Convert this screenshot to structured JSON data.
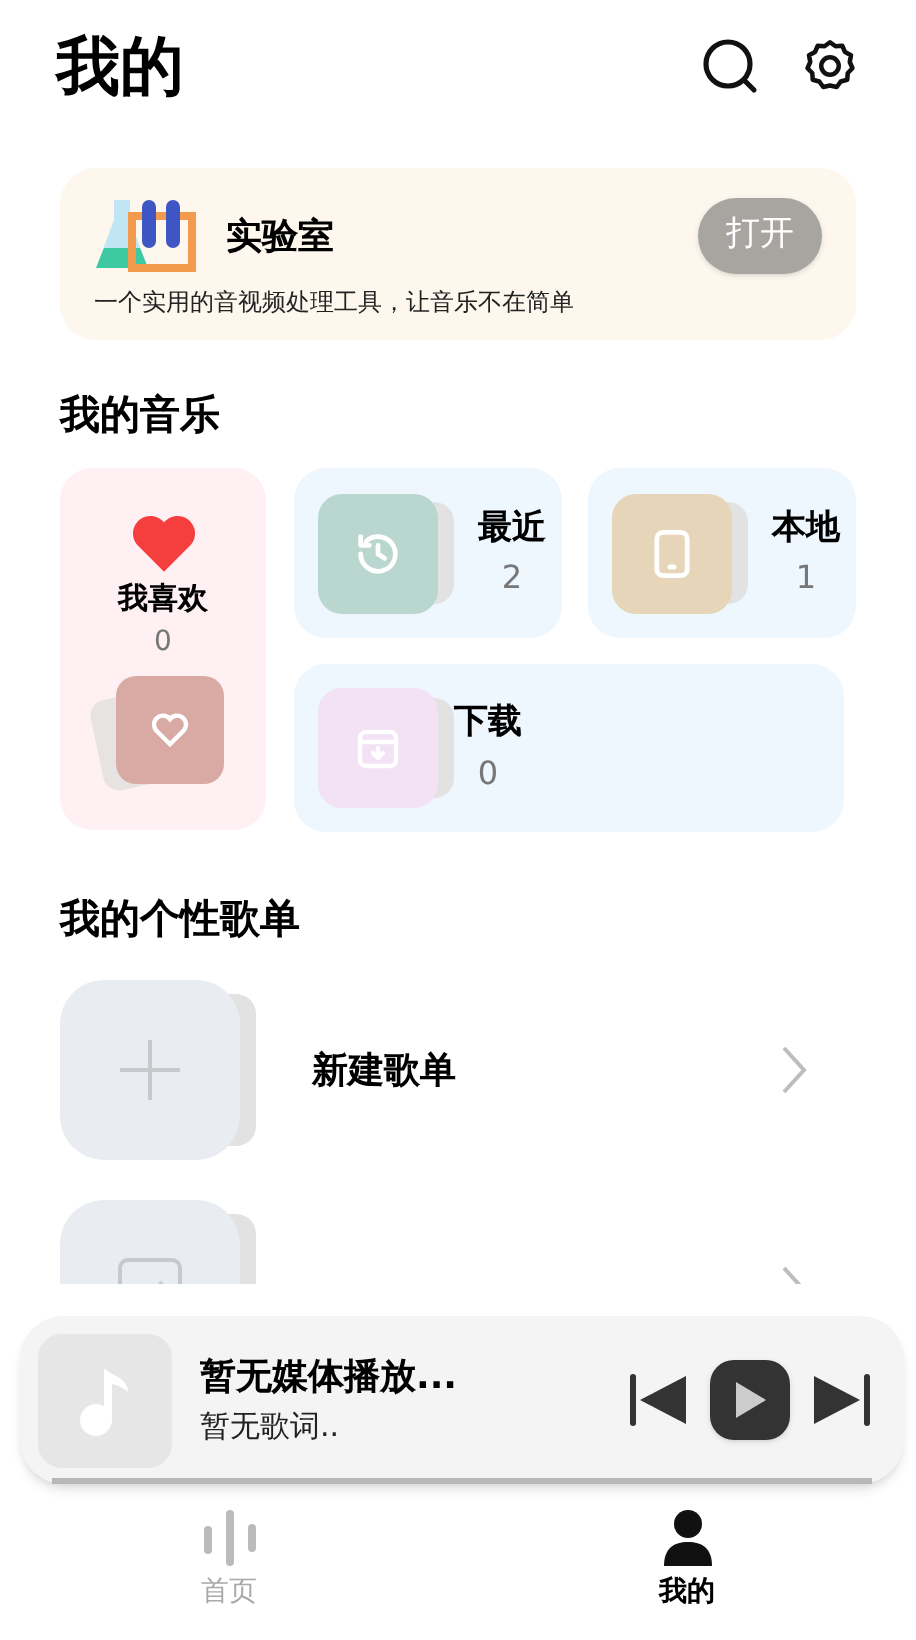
{
  "header": {
    "title": "我的"
  },
  "lab": {
    "title": "实验室",
    "description": "一个实用的音视频处理工具，让音乐不在简单",
    "button": "打开"
  },
  "my_music": {
    "heading": "我的音乐",
    "favorites": {
      "label": "我喜欢",
      "count": "0",
      "color": "#d8aaa3"
    },
    "items": [
      {
        "kind": "recent",
        "label": "最近",
        "count": "2",
        "color": "#b9d7cf"
      },
      {
        "kind": "local",
        "label": "本地",
        "count": "1",
        "color": "#e6d5b8"
      },
      {
        "kind": "download",
        "label": "下载",
        "count": "0",
        "color": "#f2e2f4"
      }
    ]
  },
  "playlists": {
    "heading": "我的个性歌单",
    "items": [
      {
        "kind": "create",
        "label": "新建歌单"
      },
      {
        "kind": "bind"
      }
    ]
  },
  "player": {
    "title": "暂无媒体播放...",
    "lyrics": "暂无歌词..",
    "playing": false,
    "level": 0
  },
  "nav": [
    {
      "kind": "home",
      "label": "首页",
      "selected": false
    },
    {
      "kind": "me",
      "label": "我的",
      "selected": true
    }
  ]
}
